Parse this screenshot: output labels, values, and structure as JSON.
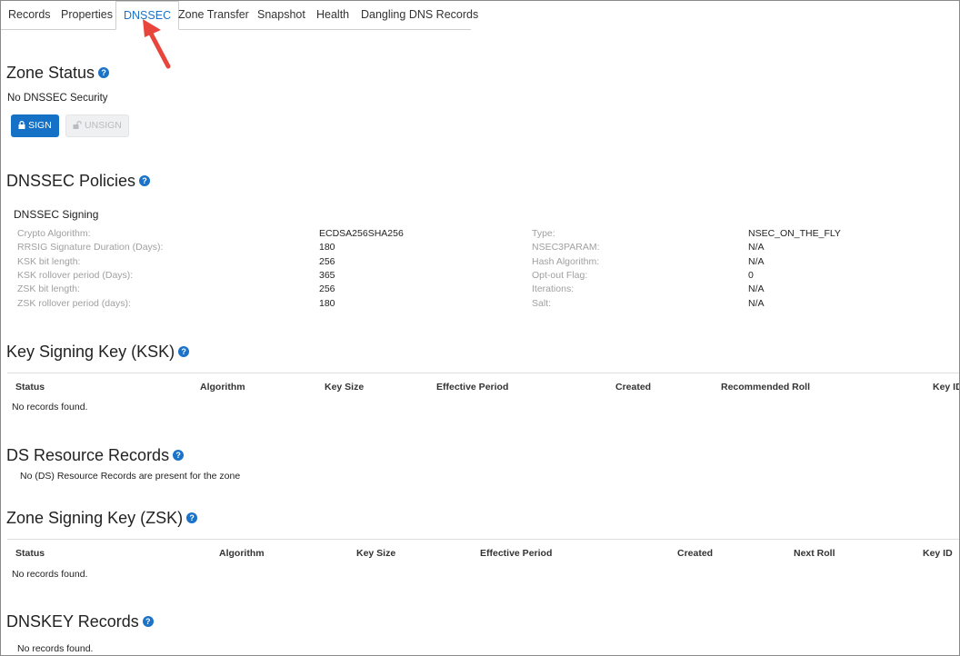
{
  "tabs": [
    {
      "label": "Records"
    },
    {
      "label": "Properties"
    },
    {
      "label": "DNSSEC"
    },
    {
      "label": "Zone Transfer"
    },
    {
      "label": "Snapshot"
    },
    {
      "label": "Health"
    },
    {
      "label": "Dangling DNS Records"
    }
  ],
  "active_tab": "DNSSEC",
  "zone_status": {
    "title": "Zone Status",
    "status_text": "No DNSSEC Security",
    "sign_label": "SIGN",
    "unsign_label": "UNSIGN"
  },
  "policies": {
    "title": "DNSSEC Policies",
    "subtitle": "DNSSEC Signing",
    "left": [
      {
        "label": "Crypto Algorithm:",
        "value": "ECDSA256SHA256"
      },
      {
        "label": "RRSIG Signature Duration (Days):",
        "value": "180"
      },
      {
        "label": "KSK bit length:",
        "value": "256"
      },
      {
        "label": "KSK rollover period (Days):",
        "value": "365"
      },
      {
        "label": "ZSK bit length:",
        "value": "256"
      },
      {
        "label": "ZSK rollover period (days):",
        "value": "180"
      }
    ],
    "right": [
      {
        "label": "Type:",
        "value": "NSEC_ON_THE_FLY"
      },
      {
        "label": "NSEC3PARAM:",
        "value": "N/A"
      },
      {
        "label": "Hash Algorithm:",
        "value": "N/A"
      },
      {
        "label": "Opt-out Flag:",
        "value": "0"
      },
      {
        "label": "Iterations:",
        "value": "N/A"
      },
      {
        "label": "Salt:",
        "value": "N/A"
      }
    ]
  },
  "ksk": {
    "title": "Key Signing Key (KSK)",
    "columns": [
      "Status",
      "Algorithm",
      "Key Size",
      "Effective Period",
      "Created",
      "Recommended Roll",
      "Key ID"
    ],
    "empty_text": "No records found."
  },
  "ds": {
    "title": "DS Resource Records",
    "empty_text": "No (DS) Resource Records are present for the zone"
  },
  "zsk": {
    "title": "Zone Signing Key (ZSK)",
    "columns": [
      "Status",
      "Algorithm",
      "Key Size",
      "Effective Period",
      "Created",
      "Next Roll",
      "Key ID"
    ],
    "empty_text": "No records found."
  },
  "dnskey": {
    "title": "DNSKEY Records",
    "empty_text": "No records found."
  },
  "help_glyph": "?",
  "colors": {
    "accent": "#1a73c8",
    "sign_button": "#1471c6",
    "arrow": "#e8453c"
  }
}
